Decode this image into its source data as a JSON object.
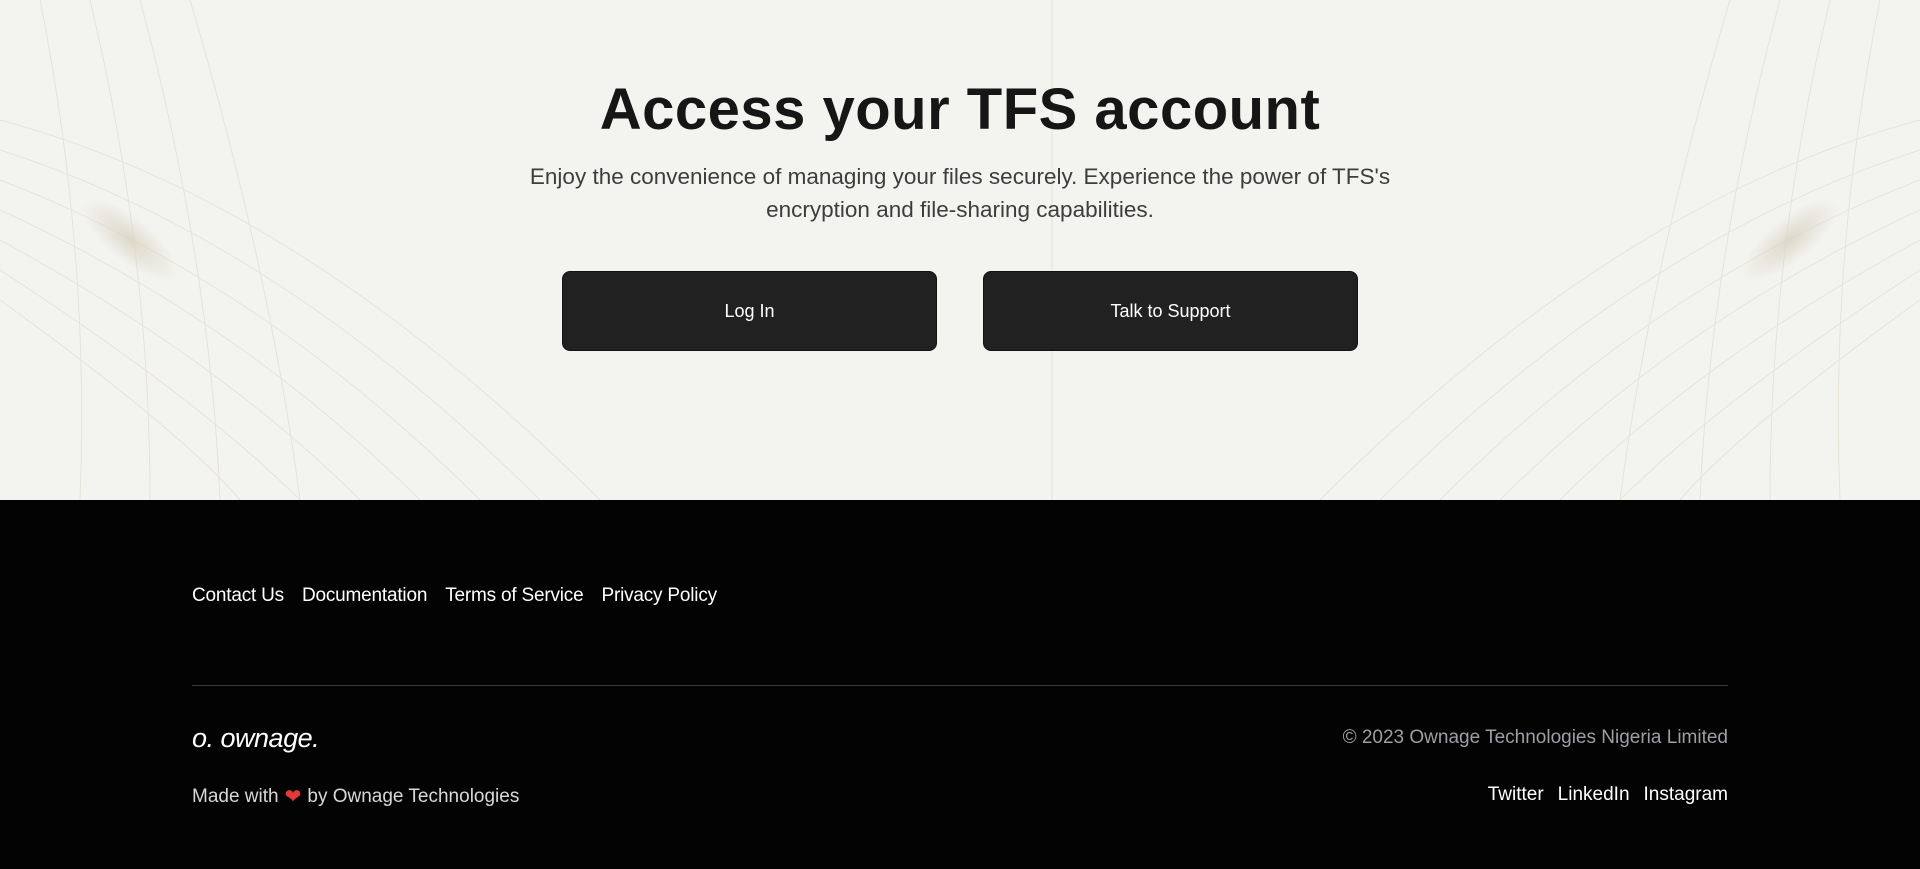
{
  "hero": {
    "title": "Access your TFS account",
    "subtitle": "Enjoy the convenience of managing your files securely. Experience the power of TFS's encryption and file-sharing capabilities.",
    "login_label": "Log In",
    "support_label": "Talk to Support"
  },
  "footer": {
    "links": [
      "Contact Us",
      "Documentation",
      "Terms of Service",
      "Privacy Policy"
    ],
    "logo_text": "o. ownage.",
    "copyright": "© 2023 Ownage Technologies Nigeria Limited",
    "made_with_prefix": "Made with",
    "made_with_icon": "heart-icon",
    "made_with_suffix": "by Ownage Technologies",
    "social": [
      "Twitter",
      "LinkedIn",
      "Instagram"
    ]
  },
  "colors": {
    "hero_bg": "#f3f3f0",
    "button_bg": "#212121",
    "footer_bg": "#030303",
    "heart": "#e53935"
  }
}
